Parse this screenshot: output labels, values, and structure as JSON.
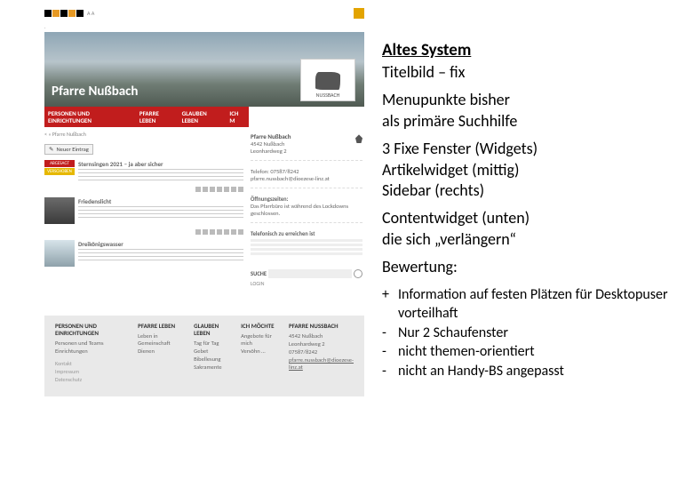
{
  "topbar": {
    "right_box": ""
  },
  "hero": {
    "title": "Pfarre Nußbach",
    "badge_label": "NUSSBACH"
  },
  "menu": {
    "items": [
      "PERSONEN UND EINRICHTUNGEN",
      "PFARRE LEBEN",
      "GLAUBEN LEBEN",
      "ICH M"
    ]
  },
  "crumb": "< « Pfarre Nußbach",
  "new_button": "Neuer Eintrag",
  "articles": [
    {
      "title": "Sternsingen 2021 – ja aber sicher"
    },
    {
      "title": "Friedenslicht"
    },
    {
      "title": "Dreikönigswasser"
    }
  ],
  "label_red": "ABGESAGT",
  "label_yellow": "VERSCHOBEN",
  "sidebar": {
    "title": "Pfarre Nußbach",
    "addr1": "4542 Nußbach",
    "addr2": "Leonhardweg 2",
    "tel": "Telefon: 07587/8242",
    "mail": "pfarre.nussbach@dioezese-linz.at",
    "hours_label": "Öffnungszeiten:",
    "hours_text": "Das Pfarrbüro ist während des Lockdowns geschlossen.",
    "reach_label": "Telefonisch zu erreichen ist",
    "search_label": "SUCHE",
    "login": "LOGIN"
  },
  "footer": {
    "cols": [
      {
        "head": "PERSONEN UND EINRICHTUNGEN",
        "rows": [
          "Personen und Teams",
          "Einrichtungen"
        ]
      },
      {
        "head": "PFARRE LEBEN",
        "rows": [
          "Leben in Gemeinschaft",
          "Dienen"
        ]
      },
      {
        "head": "GLAUBEN LEBEN",
        "rows": [
          "Tag für Tag",
          "Gebet",
          "Bibellesung",
          "Sakramente"
        ]
      },
      {
        "head": "ICH MÖCHTE",
        "rows": [
          "Angebote für mich",
          "Versöhn …"
        ]
      },
      {
        "head": "PFARRE NUSSBACH",
        "rows": [
          "4542 Nußbach",
          "Leonhardweg 2",
          "07587/8242",
          "pfarre.nussbach@dioezese-linz.at"
        ]
      }
    ],
    "meta": [
      "Kontakt",
      "Impressum",
      "Datenschutz"
    ]
  },
  "notes": {
    "heading": "Altes System",
    "line1": "Titelbild – fix",
    "line2a": "Menupunkte bisher",
    "line2b": "als primäre Suchhilfe",
    "line3a": "3 Fixe Fenster (Widgets)",
    "line3b": "Artikelwidget (mittig)",
    "line3c": "Sidebar (rechts)",
    "line4a": "Contentwidget (unten)",
    "line4b": "die sich „verlängern“",
    "line5": "Bewertung:",
    "bullets": [
      {
        "sign": "+",
        "text": "Information auf festen Plätzen für Desktopuser vorteilhaft"
      },
      {
        "sign": "-",
        "text": "Nur 2 Schaufenster"
      },
      {
        "sign": "-",
        "text": "nicht themen-orientiert"
      },
      {
        "sign": "-",
        "text": "nicht an Handy-BS angepasst"
      }
    ]
  }
}
